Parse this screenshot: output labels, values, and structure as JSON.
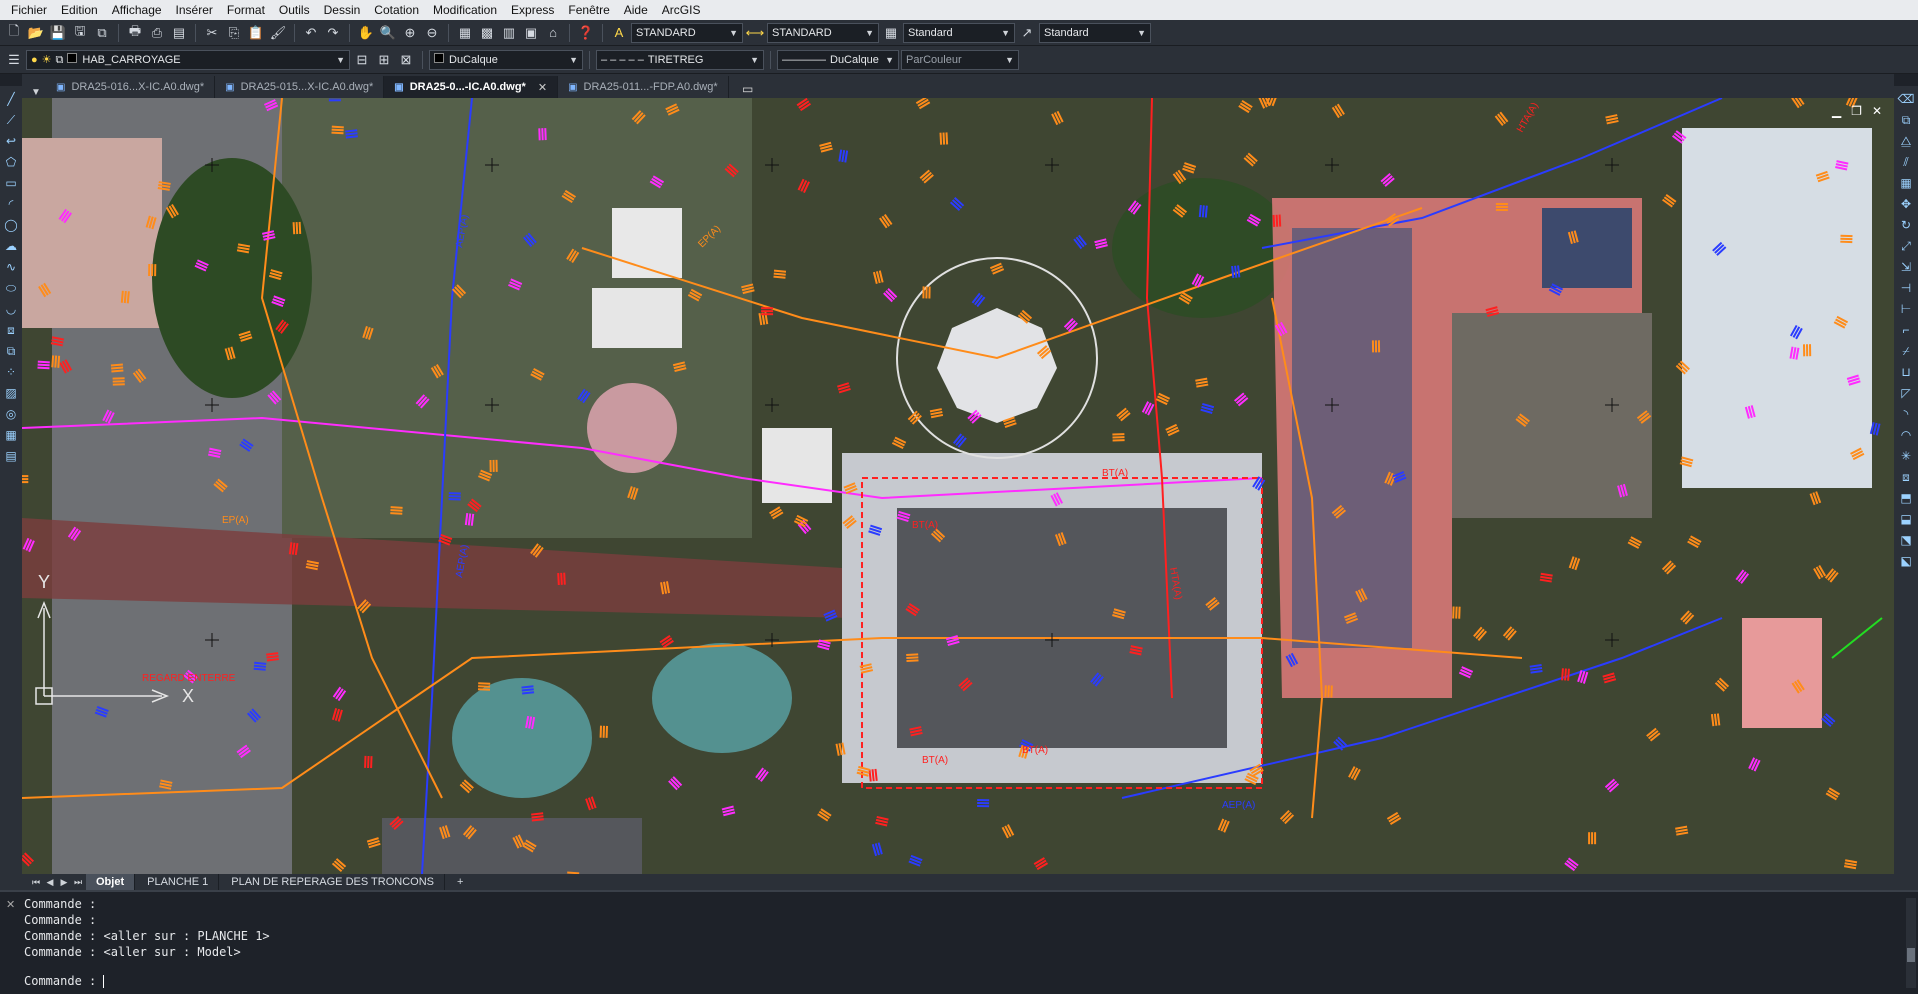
{
  "menubar": {
    "items": [
      "Fichier",
      "Edition",
      "Affichage",
      "Insérer",
      "Format",
      "Outils",
      "Dessin",
      "Cotation",
      "Modification",
      "Express",
      "Fenêtre",
      "Aide",
      "ArcGIS"
    ]
  },
  "toolbar1": {
    "text_style": "STANDARD",
    "dim_style": "STANDARD",
    "table_style": "Standard",
    "mleader_style": "Standard"
  },
  "toolbar2": {
    "layer": "HAB_CARROYAGE",
    "color": "DuCalque",
    "linetype_preview": "– – – – –",
    "linetype": "TIRETREG",
    "lineweight_preview": "————",
    "lineweight": "DuCalque",
    "plotstyle": "ParCouleur"
  },
  "doc_tabs": [
    {
      "label": "DRA25-016...X-IC.A0.dwg*",
      "active": false,
      "has_dropdown": true
    },
    {
      "label": "DRA25-015...X-IC.A0.dwg*",
      "active": false
    },
    {
      "label": "DRA25-0...-IC.A0.dwg*",
      "active": true
    },
    {
      "label": "DRA25-011...-FDP.A0.dwg*",
      "active": false
    }
  ],
  "viewport": {
    "labels": {
      "aep": "AEP(A)",
      "bt": "BT(A)",
      "ep": "EP(A)",
      "hta": "HTA(A)",
      "regard": "REGARD ENTERRE"
    },
    "ucs": {
      "x": "X",
      "y": "Y"
    }
  },
  "layout_tabs": [
    "Objet",
    "PLANCHE 1",
    "PLAN DE REPERAGE DES TRONCONS"
  ],
  "layout_tab_add": "+",
  "command": {
    "history": [
      "Commande :",
      "Commande :",
      "Commande : <aller sur : PLANCHE 1>",
      "Commande : <aller sur : Model>"
    ],
    "prompt": "Commande : "
  },
  "colors": {
    "orange": "#ff8c1a",
    "red": "#ff2020",
    "magenta": "#ff2cff",
    "blue": "#2a3cff",
    "roof_red": "#e86f6f",
    "green": "#22dd22"
  }
}
